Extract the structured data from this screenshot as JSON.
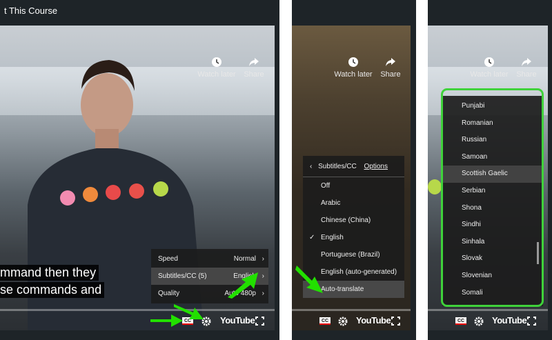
{
  "course_title": "t This Course",
  "top_actions": {
    "watch_later": "Watch later",
    "share": "Share"
  },
  "captions": [
    "mmand then they",
    "se commands and"
  ],
  "settings_menu": [
    {
      "label": "Speed",
      "value": "Normal"
    },
    {
      "label": "Subtitles/CC (5)",
      "value": "English"
    },
    {
      "label": "Quality",
      "value": "Auto 480p"
    }
  ],
  "subtitle_menu": {
    "header": "Subtitles/CC",
    "options_link": "Options",
    "items": [
      "Off",
      "Arabic",
      "Chinese (China)",
      "English",
      "Portuguese (Brazil)",
      "English (auto-generated)",
      "Auto-translate"
    ],
    "checked": "English",
    "highlighted": "Auto-translate"
  },
  "languages": [
    "Punjabi",
    "Romanian",
    "Russian",
    "Samoan",
    "Scottish Gaelic",
    "Serbian",
    "Shona",
    "Sindhi",
    "Sinhala",
    "Slovak",
    "Slovenian",
    "Somali"
  ],
  "selected_language": "Scottish Gaelic",
  "player": {
    "cc": "CC",
    "logo": "YouTube"
  },
  "colors": {
    "annotation_green": "#22e000",
    "panel_bg": "#1e2428",
    "highlight_border": "#3fd23a"
  }
}
